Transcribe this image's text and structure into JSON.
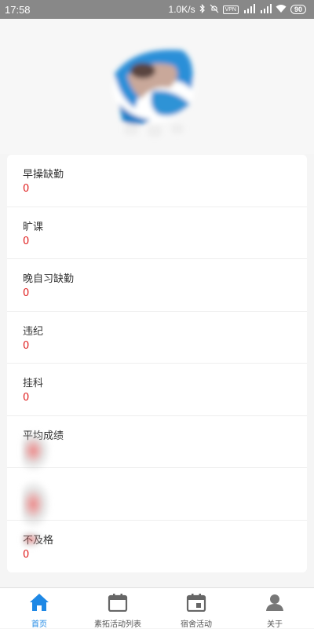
{
  "status_bar": {
    "time": "17:58",
    "network_speed": "1.0K/s",
    "vpn_label": "VPN",
    "battery": "90"
  },
  "profile": {
    "avatar_icon": "user-avatar-photo"
  },
  "stats": [
    {
      "label": "早操缺勤",
      "value": "0"
    },
    {
      "label": "旷课",
      "value": "0"
    },
    {
      "label": "晚自习缺勤",
      "value": "0"
    },
    {
      "label": "违纪",
      "value": "0"
    },
    {
      "label": "挂科",
      "value": "0"
    },
    {
      "label": "平均成绩",
      "value": ""
    },
    {
      "label": "",
      "value": ""
    },
    {
      "label": "不及格",
      "value": "0"
    }
  ],
  "tabs": [
    {
      "label": "首页",
      "icon": "home-icon",
      "active": true
    },
    {
      "label": "素拓活动列表",
      "icon": "calendar-icon",
      "active": false
    },
    {
      "label": "宿舍活动",
      "icon": "calendar-event-icon",
      "active": false
    },
    {
      "label": "关于",
      "icon": "person-icon",
      "active": false
    }
  ],
  "colors": {
    "accent": "#1e88e5",
    "value_red": "#e02020",
    "status_bar": "#888888",
    "inactive_icon": "#777777"
  }
}
